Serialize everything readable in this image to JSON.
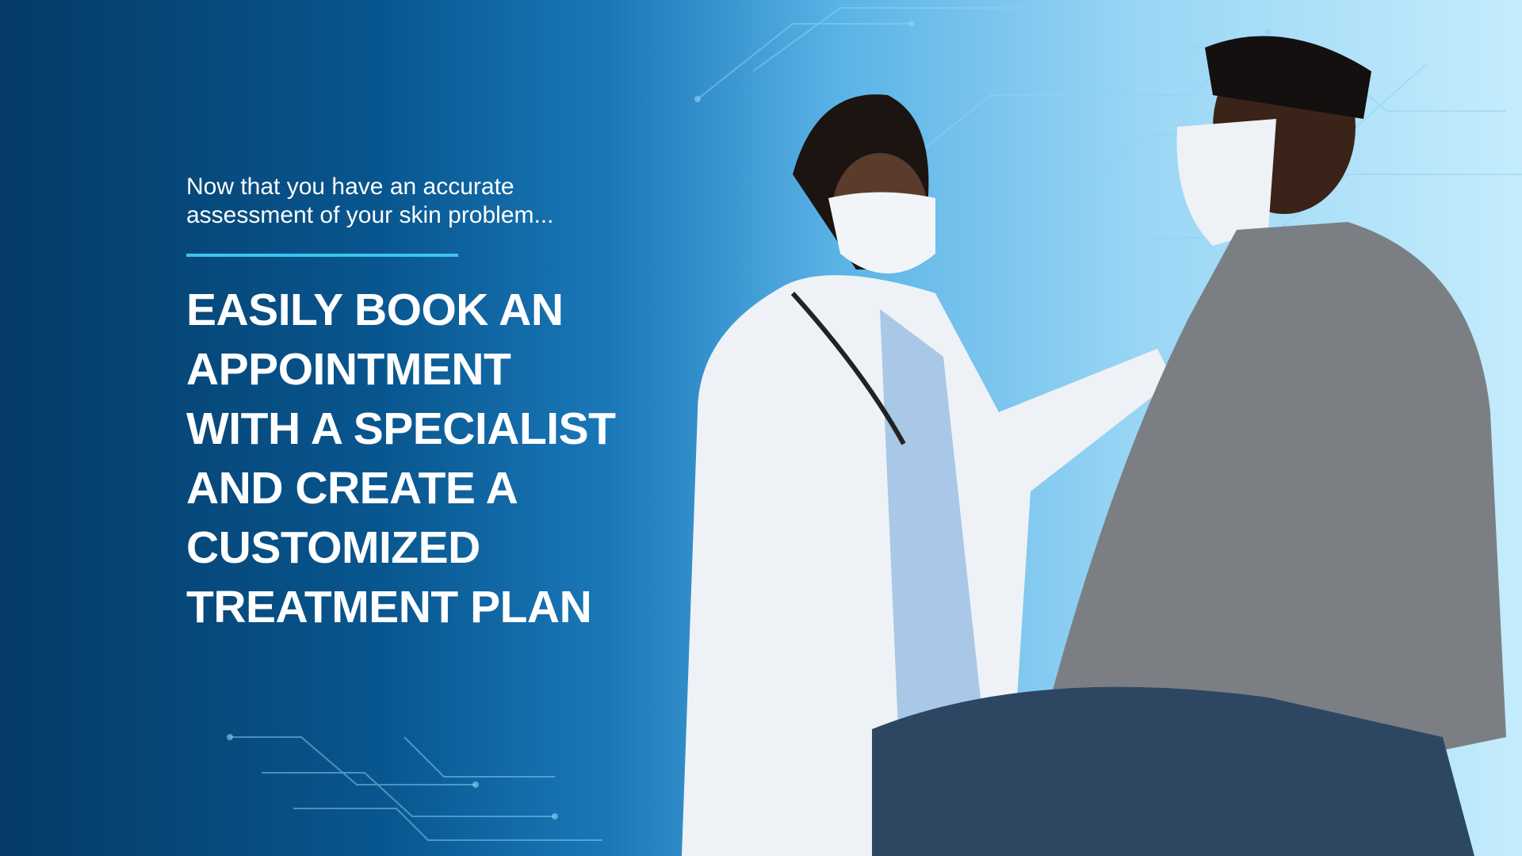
{
  "hero": {
    "subtitle_line1": "Now that you have an accurate",
    "subtitle_line2": "assessment of your skin problem...",
    "headline": [
      "EASILY BOOK AN",
      "APPOINTMENT",
      "WITH A SPECIALIST",
      "AND CREATE A",
      "CUSTOMIZED",
      "TREATMENT PLAN"
    ],
    "accent_color": "#3ec3f0"
  }
}
